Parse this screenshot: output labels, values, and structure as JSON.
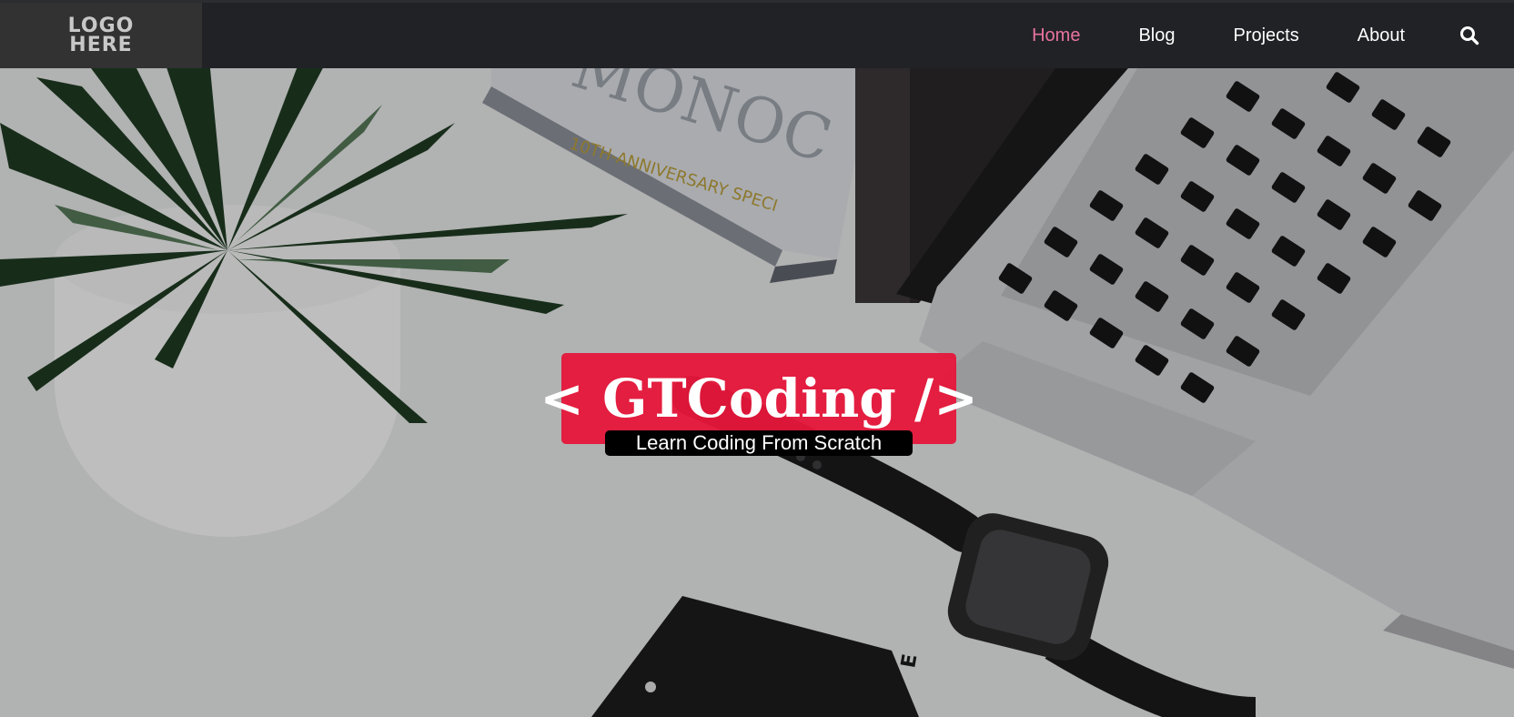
{
  "logo": {
    "line1": "LOGO",
    "line2": "HERE"
  },
  "nav": {
    "items": [
      {
        "label": "Home",
        "active": true
      },
      {
        "label": "Blog",
        "active": false
      },
      {
        "label": "Projects",
        "active": false
      },
      {
        "label": "About",
        "active": false
      }
    ],
    "search_icon": "search-icon",
    "active_color": "#e8739e"
  },
  "hero": {
    "title": "< GTCoding />",
    "tagline": "Learn Coding From Scratch",
    "title_bg_color": "#e6163a",
    "tagline_bg_color": "#000000",
    "background_image": "desk-with-plant-laptop-watch-phone"
  },
  "colors": {
    "navbar_bg": "#212226",
    "logo_bg": "#323233"
  }
}
